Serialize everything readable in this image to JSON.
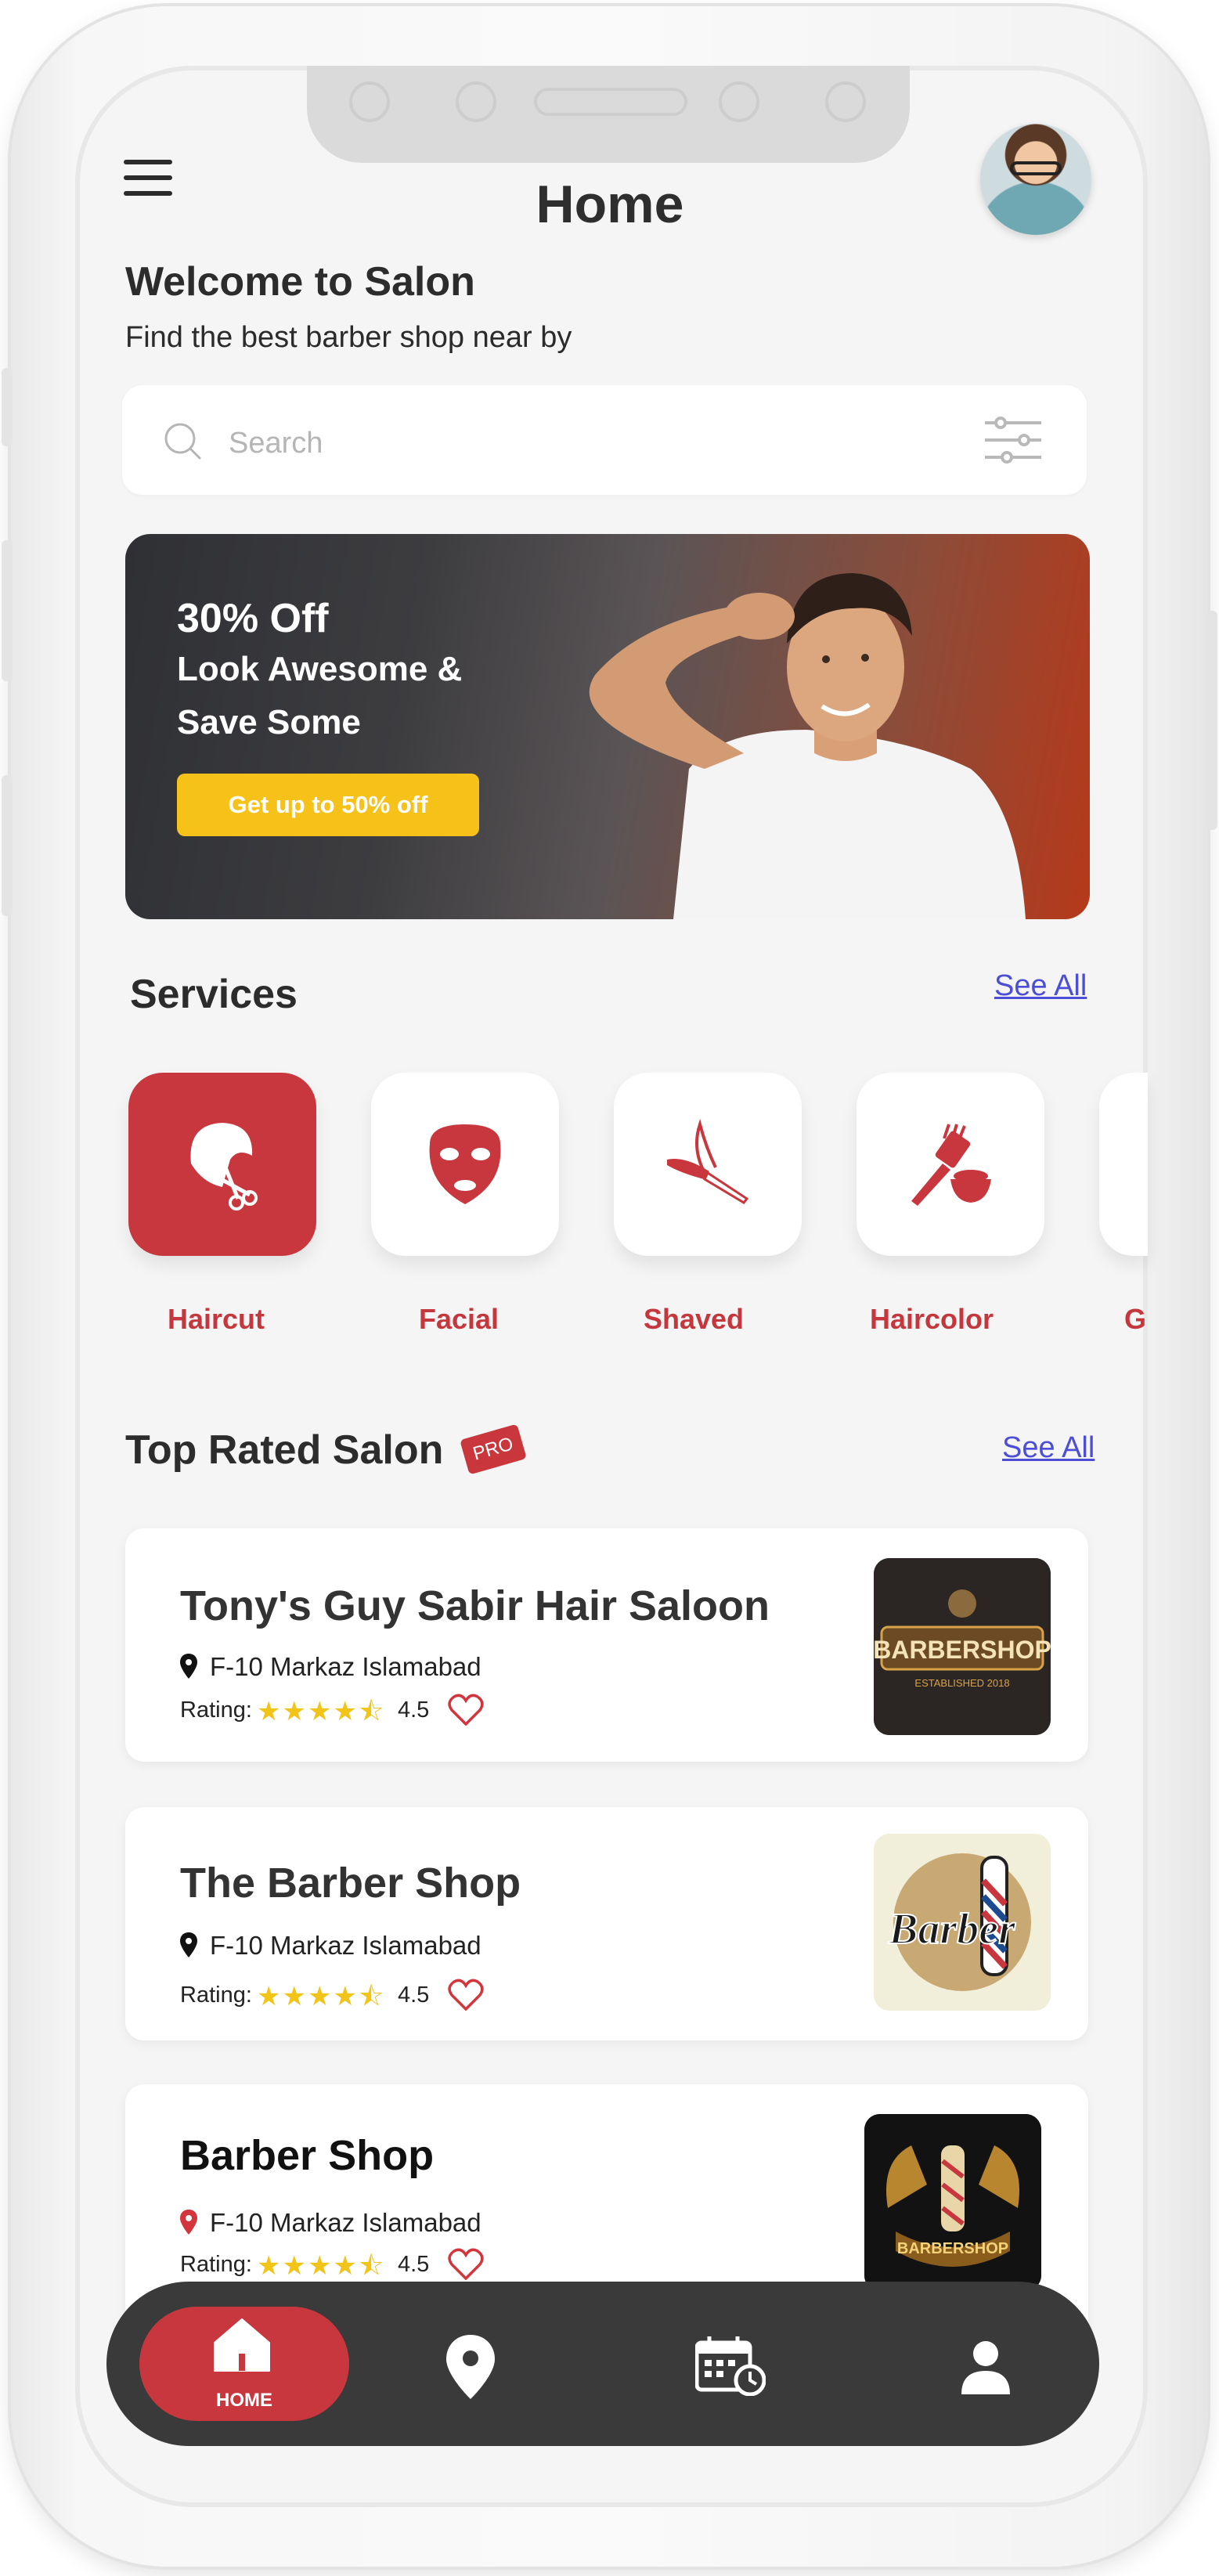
{
  "header": {
    "title": "Home",
    "welcome": "Welcome to Salon",
    "subtitle": "Find the best barber shop near by"
  },
  "search": {
    "placeholder": "Search",
    "value": ""
  },
  "banner": {
    "line1": "30% Off",
    "line2": "Look Awesome &",
    "line3": "Save Some",
    "button_label": "Get up to 50% off"
  },
  "services": {
    "title": "Services",
    "see_all": "See All",
    "items": [
      {
        "label": "Haircut",
        "icon": "haircut-scissors-icon",
        "active": true
      },
      {
        "label": "Facial",
        "icon": "face-mask-icon",
        "active": false
      },
      {
        "label": "Shaved",
        "icon": "razor-icon",
        "active": false
      },
      {
        "label": "Haircolor",
        "icon": "hair-dye-brush-icon",
        "active": false
      },
      {
        "label": "G",
        "icon": "partial-service-icon",
        "active": false
      }
    ]
  },
  "top_rated": {
    "title": "Top Rated Salon",
    "badge": "PRO",
    "see_all": "See All",
    "salons": [
      {
        "name": "Tony's Guy Sabir Hair Saloon",
        "location": "F-10 Markaz Islamabad",
        "rating_label": "Rating:",
        "rating": "4.5",
        "logo_text": "BARBERSHOP",
        "logo_subtext": "ESTABLISHED 2018"
      },
      {
        "name": "The Barber Shop",
        "location": "F-10 Markaz Islamabad",
        "rating_label": "Rating:",
        "rating": "4.5",
        "logo_text": "Barber"
      },
      {
        "name": "Barber Shop",
        "location": "F-10 Markaz Islamabad",
        "rating_label": "Rating:",
        "rating": "4.5",
        "logo_text": "BARBERSHOP"
      }
    ]
  },
  "bottom_nav": {
    "home_label": "HOME",
    "items": [
      "home-icon",
      "location-pin-icon",
      "calendar-clock-icon",
      "user-icon"
    ]
  },
  "colors": {
    "accent": "#c8373e",
    "banner_button": "#f6c21a",
    "link": "#4c4fd6",
    "star": "#f2c417",
    "nav_bg": "#3a3a3a"
  }
}
